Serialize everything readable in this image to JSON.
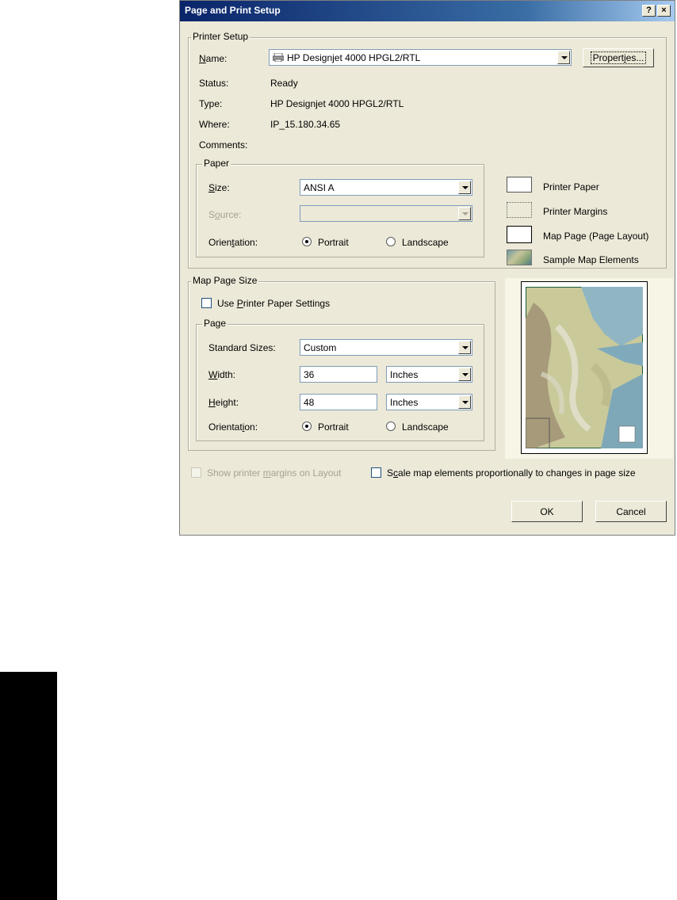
{
  "window": {
    "title": "Page and Print Setup",
    "help_button": "?",
    "close_button": "×"
  },
  "printer_setup": {
    "legend": "Printer Setup",
    "name_label": "Name:",
    "name_value": "HP Designjet 4000 HPGL2/RTL",
    "properties_button": "Properties...",
    "status_label": "Status:",
    "status_value": "Ready",
    "type_label": "Type:",
    "type_value": "HP Designjet 4000 HPGL2/RTL",
    "where_label": "Where:",
    "where_value": "IP_15.180.34.65",
    "comments_label": "Comments:"
  },
  "paper": {
    "legend": "Paper",
    "size_label": "Size:",
    "size_value": "ANSI A",
    "source_label": "Source:",
    "source_value": "",
    "orientation_label": "Orientation:",
    "portrait_label": "Portrait",
    "landscape_label": "Landscape",
    "selected": "Portrait"
  },
  "legend_panel": {
    "printer_paper": "Printer Paper",
    "printer_margins": "Printer Margins",
    "map_page": "Map Page (Page Layout)",
    "sample_elements": "Sample Map Elements"
  },
  "map_page_size": {
    "legend": "Map Page Size",
    "use_printer_paper_label": "Use Printer Paper Settings",
    "use_printer_paper_checked": false,
    "page_legend": "Page",
    "standard_sizes_label": "Standard Sizes:",
    "standard_sizes_value": "Custom",
    "width_label": "Width:",
    "width_value": "36",
    "width_unit": "Inches",
    "height_label": "Height:",
    "height_value": "48",
    "height_unit": "Inches",
    "orientation_label": "Orientation:",
    "portrait_label": "Portrait",
    "landscape_label": "Landscape",
    "selected": "Portrait"
  },
  "options": {
    "show_margins_label": "Show printer margins on Layout",
    "scale_elements_label": "Scale map elements proportionally to changes in page size"
  },
  "buttons": {
    "ok": "OK",
    "cancel": "Cancel"
  },
  "colors": {
    "title_gradient_start": "#0a246a",
    "dialog_bg": "#ece9d8",
    "black_tab": "#000000"
  }
}
